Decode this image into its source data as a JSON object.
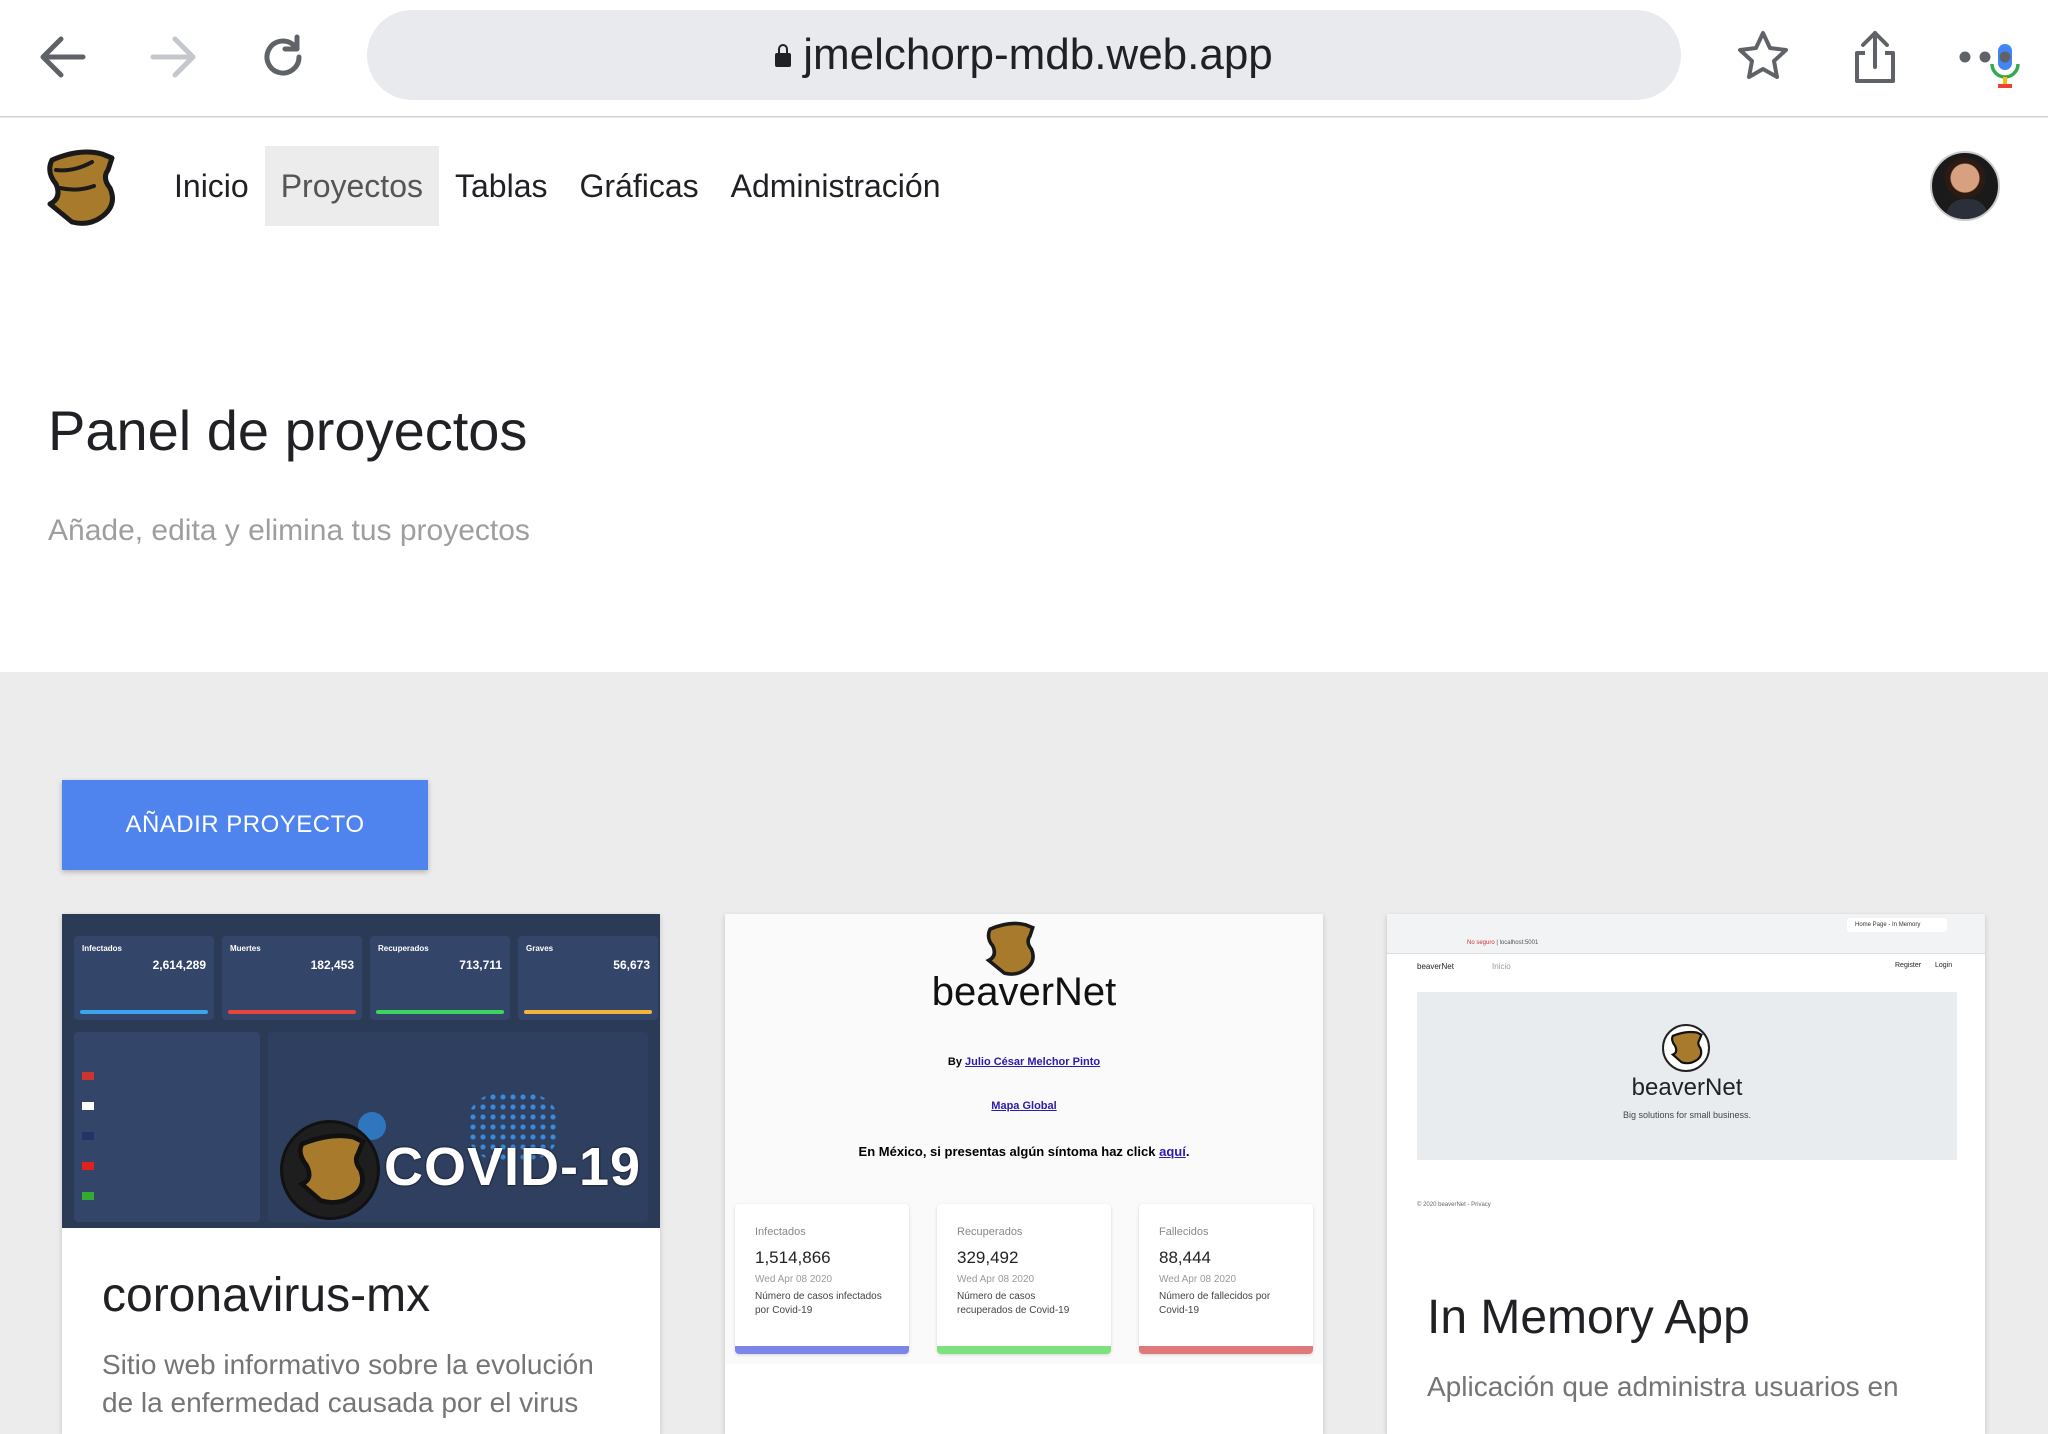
{
  "browser": {
    "url": "jmelchorp-mdb.web.app"
  },
  "nav": {
    "items": [
      {
        "label": "Inicio"
      },
      {
        "label": "Proyectos"
      },
      {
        "label": "Tablas"
      },
      {
        "label": "Gráficas"
      },
      {
        "label": "Administración"
      }
    ],
    "active": "Proyectos"
  },
  "header": {
    "title": "Panel de proyectos",
    "subtitle": "Añade, edita y elimina tus proyectos"
  },
  "actions": {
    "add_label": "AÑADIR PROYECTO"
  },
  "projects": [
    {
      "title": "coronavirus-mx",
      "description": "Sitio web informativo sobre la evolución de la enfermedad causada por el virus",
      "image": {
        "stats": [
          {
            "label": "Infectados",
            "value": "2,614,289"
          },
          {
            "label": "Muertes",
            "value": "182,453"
          },
          {
            "label": "Recuperados",
            "value": "713,711"
          },
          {
            "label": "Graves",
            "value": "56,673"
          }
        ],
        "banner": "COVID-19"
      }
    },
    {
      "title": "",
      "description": "",
      "image": {
        "brand": "beaverNet",
        "by_prefix": "By",
        "by_name": "Julio César Melchor Pinto",
        "map_link": "Mapa Global",
        "notice": "En México, si presentas algún síntoma haz click",
        "notice_link": "aquí",
        "stats": [
          {
            "label": "Infectados",
            "value": "1,514,866",
            "date": "Wed Apr 08 2020",
            "note": "Número de casos infectados por Covid-19",
            "color": "#7b86e8"
          },
          {
            "label": "Recuperados",
            "value": "329,492",
            "date": "Wed Apr 08 2020",
            "note": "Número de casos recuperados de Covid-19",
            "color": "#7fe07f"
          },
          {
            "label": "Fallecidos",
            "value": "88,444",
            "date": "Wed Apr 08 2020",
            "note": "Número de fallecidos por Covid-19",
            "color": "#e07a7a"
          }
        ]
      }
    },
    {
      "title": "In Memory App",
      "description": "Aplicación que administra usuarios en",
      "image": {
        "site_name": "beaverNet",
        "nav_inicio": "Inicio",
        "register": "Register",
        "login": "Login",
        "brand": "beaverNet",
        "tagline": "Big solutions for small business.",
        "footer": "© 2020 beaverNet - Privacy",
        "address": "localhost:5001",
        "security": "No seguro",
        "tab": "Home Page - In Memory"
      }
    }
  ],
  "colors": {
    "accent": "#4f84ee",
    "logo": "#a87b2c"
  }
}
